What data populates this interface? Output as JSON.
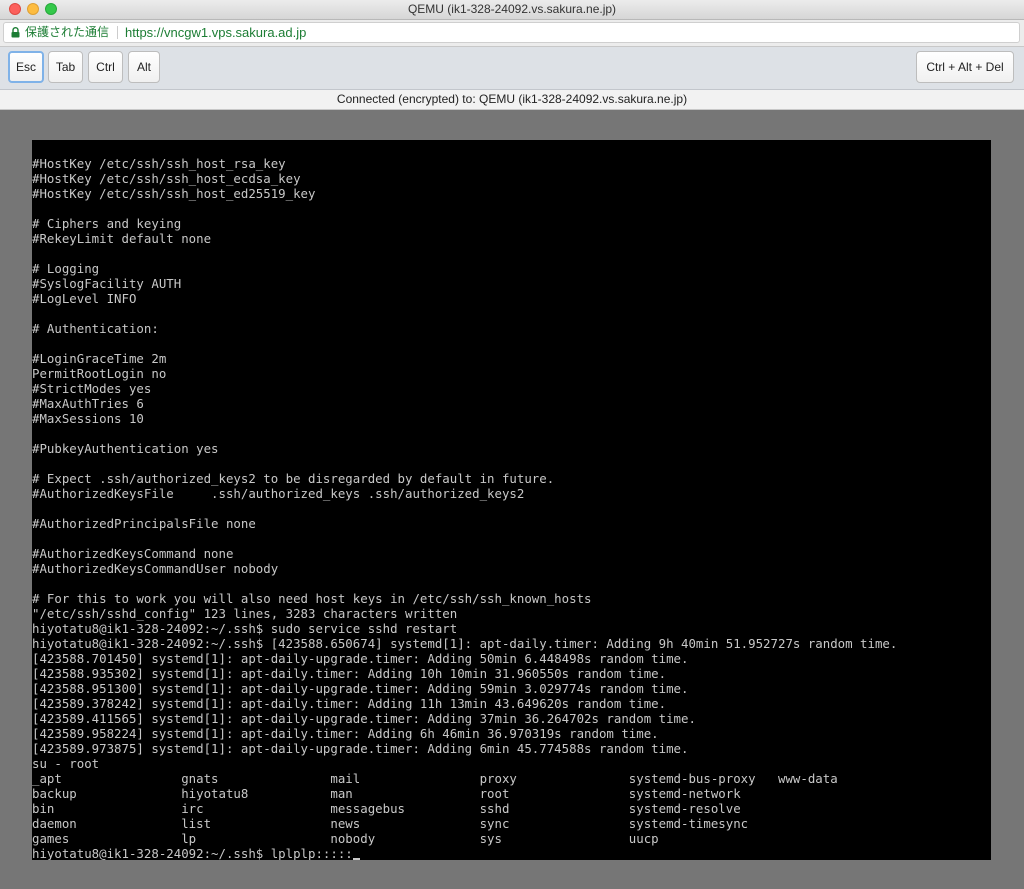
{
  "window": {
    "title": "QEMU (ik1-328-24092.vs.sakura.ne.jp)"
  },
  "address_bar": {
    "secure_label": "保護された通信",
    "url": "https://vncgw1.vps.sakura.ad.jp"
  },
  "toolbar": {
    "esc_label": "Esc",
    "tab_label": "Tab",
    "ctrl_label": "Ctrl",
    "alt_label": "Alt",
    "ctrl_alt_del_label": "Ctrl + Alt + Del"
  },
  "status": {
    "text": "Connected (encrypted) to: QEMU (ik1-328-24092.vs.sakura.ne.jp)"
  },
  "terminal": {
    "lines": [
      "#HostKey /etc/ssh/ssh_host_rsa_key",
      "#HostKey /etc/ssh/ssh_host_ecdsa_key",
      "#HostKey /etc/ssh/ssh_host_ed25519_key",
      "",
      "# Ciphers and keying",
      "#RekeyLimit default none",
      "",
      "# Logging",
      "#SyslogFacility AUTH",
      "#LogLevel INFO",
      "",
      "# Authentication:",
      "",
      "#LoginGraceTime 2m",
      "PermitRootLogin no",
      "#StrictModes yes",
      "#MaxAuthTries 6",
      "#MaxSessions 10",
      "",
      "#PubkeyAuthentication yes",
      "",
      "# Expect .ssh/authorized_keys2 to be disregarded by default in future.",
      "#AuthorizedKeysFile     .ssh/authorized_keys .ssh/authorized_keys2",
      "",
      "#AuthorizedPrincipalsFile none",
      "",
      "#AuthorizedKeysCommand none",
      "#AuthorizedKeysCommandUser nobody",
      "",
      "# For this to work you will also need host keys in /etc/ssh/ssh_known_hosts",
      "\"/etc/ssh/sshd_config\" 123 lines, 3283 characters written",
      "hiyotatu8@ik1-328-24092:~/.ssh$ sudo service sshd restart",
      "hiyotatu8@ik1-328-24092:~/.ssh$ [423588.650674] systemd[1]: apt-daily.timer: Adding 9h 40min 51.952727s random time.",
      "[423588.701450] systemd[1]: apt-daily-upgrade.timer: Adding 50min 6.448498s random time.",
      "[423588.935302] systemd[1]: apt-daily.timer: Adding 10h 10min 31.960550s random time.",
      "[423588.951300] systemd[1]: apt-daily-upgrade.timer: Adding 59min 3.029774s random time.",
      "[423589.378242] systemd[1]: apt-daily.timer: Adding 11h 13min 43.649620s random time.",
      "[423589.411565] systemd[1]: apt-daily-upgrade.timer: Adding 37min 36.264702s random time.",
      "[423589.958224] systemd[1]: apt-daily.timer: Adding 6h 46min 36.970319s random time.",
      "[423589.973875] systemd[1]: apt-daily-upgrade.timer: Adding 6min 45.774588s random time.",
      "su - root",
      "_apt                gnats               mail                proxy               systemd-bus-proxy   www-data",
      "backup              hiyotatu8           man                 root                systemd-network",
      "bin                 irc                 messagebus          sshd                systemd-resolve",
      "daemon              list                news                sync                systemd-timesync",
      "games               lp                  nobody              sys                 uucp",
      "hiyotatu8@ik1-328-24092:~/.ssh$ lplplp:::::"
    ]
  },
  "colors": {
    "terminal_bg": "#000000",
    "terminal_fg": "#c8c8c8",
    "secure_green": "#1c7d34"
  }
}
